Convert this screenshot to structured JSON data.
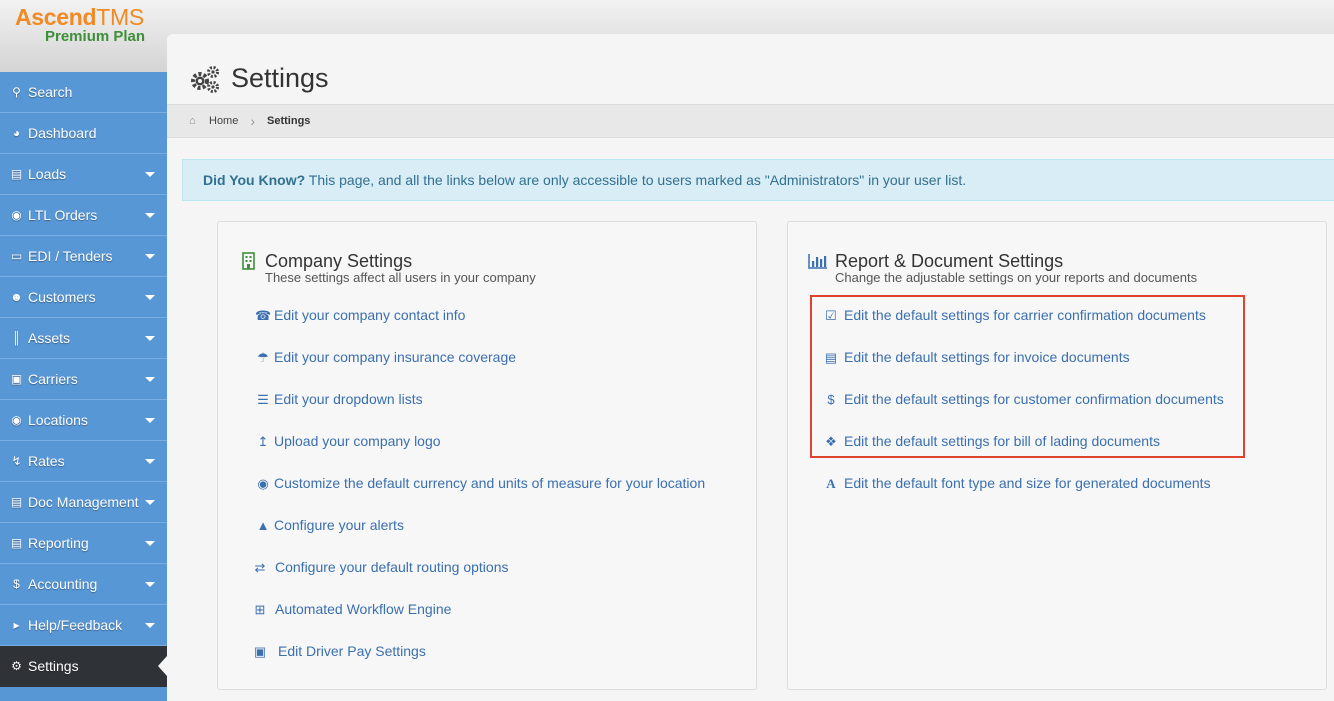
{
  "logo": {
    "brand_a": "Ascend",
    "brand_b": "TMS",
    "plan": "Premium Plan"
  },
  "sidebar": {
    "items": [
      {
        "label": "Search",
        "icon": "search-icon"
      },
      {
        "label": "Dashboard",
        "icon": "dashboard-icon"
      },
      {
        "label": "Loads",
        "icon": "loads-icon"
      },
      {
        "label": "LTL Orders",
        "icon": "ltl-icon"
      },
      {
        "label": "EDI / Tenders",
        "icon": "edi-icon"
      },
      {
        "label": "Customers",
        "icon": "customers-icon"
      },
      {
        "label": "Assets",
        "icon": "barcode-icon"
      },
      {
        "label": "Carriers",
        "icon": "truck-icon"
      },
      {
        "label": "Locations",
        "icon": "map-marker-icon"
      },
      {
        "label": "Rates",
        "icon": "bolt-icon"
      },
      {
        "label": "Doc Management",
        "icon": "document-icon"
      },
      {
        "label": "Reporting",
        "icon": "report-icon"
      },
      {
        "label": "Accounting",
        "icon": "dollar-icon"
      },
      {
        "label": "Help/Feedback",
        "icon": "megaphone-icon"
      },
      {
        "label": "Settings",
        "icon": "gears-icon"
      }
    ]
  },
  "header": {
    "title": "Settings"
  },
  "breadcrumb": {
    "home": "Home",
    "current": "Settings"
  },
  "alert": {
    "bold": "Did You Know?",
    "text": "This page, and all the links below are only accessible to users marked as \"Administrators\" in your user list."
  },
  "company": {
    "title": "Company Settings",
    "subtitle": "These settings affect all users in your company",
    "links": [
      {
        "label": "Edit your company contact info",
        "icon": "phone-icon"
      },
      {
        "label": "Edit your company insurance coverage",
        "icon": "umbrella-icon"
      },
      {
        "label": "Edit your dropdown lists",
        "icon": "list-icon"
      },
      {
        "label": "Upload your company logo",
        "icon": "upload-icon"
      },
      {
        "label": "Customize the default currency and units of measure for your location",
        "icon": "globe-icon"
      },
      {
        "label": "Configure your alerts",
        "icon": "bell-icon"
      },
      {
        "label": "Configure your default routing options",
        "icon": "random-icon"
      },
      {
        "label": "Automated Workflow Engine",
        "icon": "workflow-icon"
      },
      {
        "label": "Edit Driver Pay Settings",
        "icon": "money-icon"
      }
    ]
  },
  "report": {
    "title": "Report & Document Settings",
    "subtitle": "Change the adjustable settings on your reports and documents",
    "links": [
      {
        "label": "Edit the default settings for carrier confirmation documents",
        "icon": "check-square-icon"
      },
      {
        "label": "Edit the default settings for invoice documents",
        "icon": "file-icon"
      },
      {
        "label": "Edit the default settings for customer confirmation documents",
        "icon": "dollar-icon"
      },
      {
        "label": "Edit the default settings for bill of lading documents",
        "icon": "dropbox-icon"
      },
      {
        "label": "Edit the default font type and size for generated documents",
        "icon": "font-icon"
      }
    ]
  },
  "colors": {
    "sidebar": "#5897d6",
    "active": "#2f3338",
    "link": "#3a6fb0",
    "highlight": "#e0432d",
    "alert_bg": "#d9edf7"
  }
}
